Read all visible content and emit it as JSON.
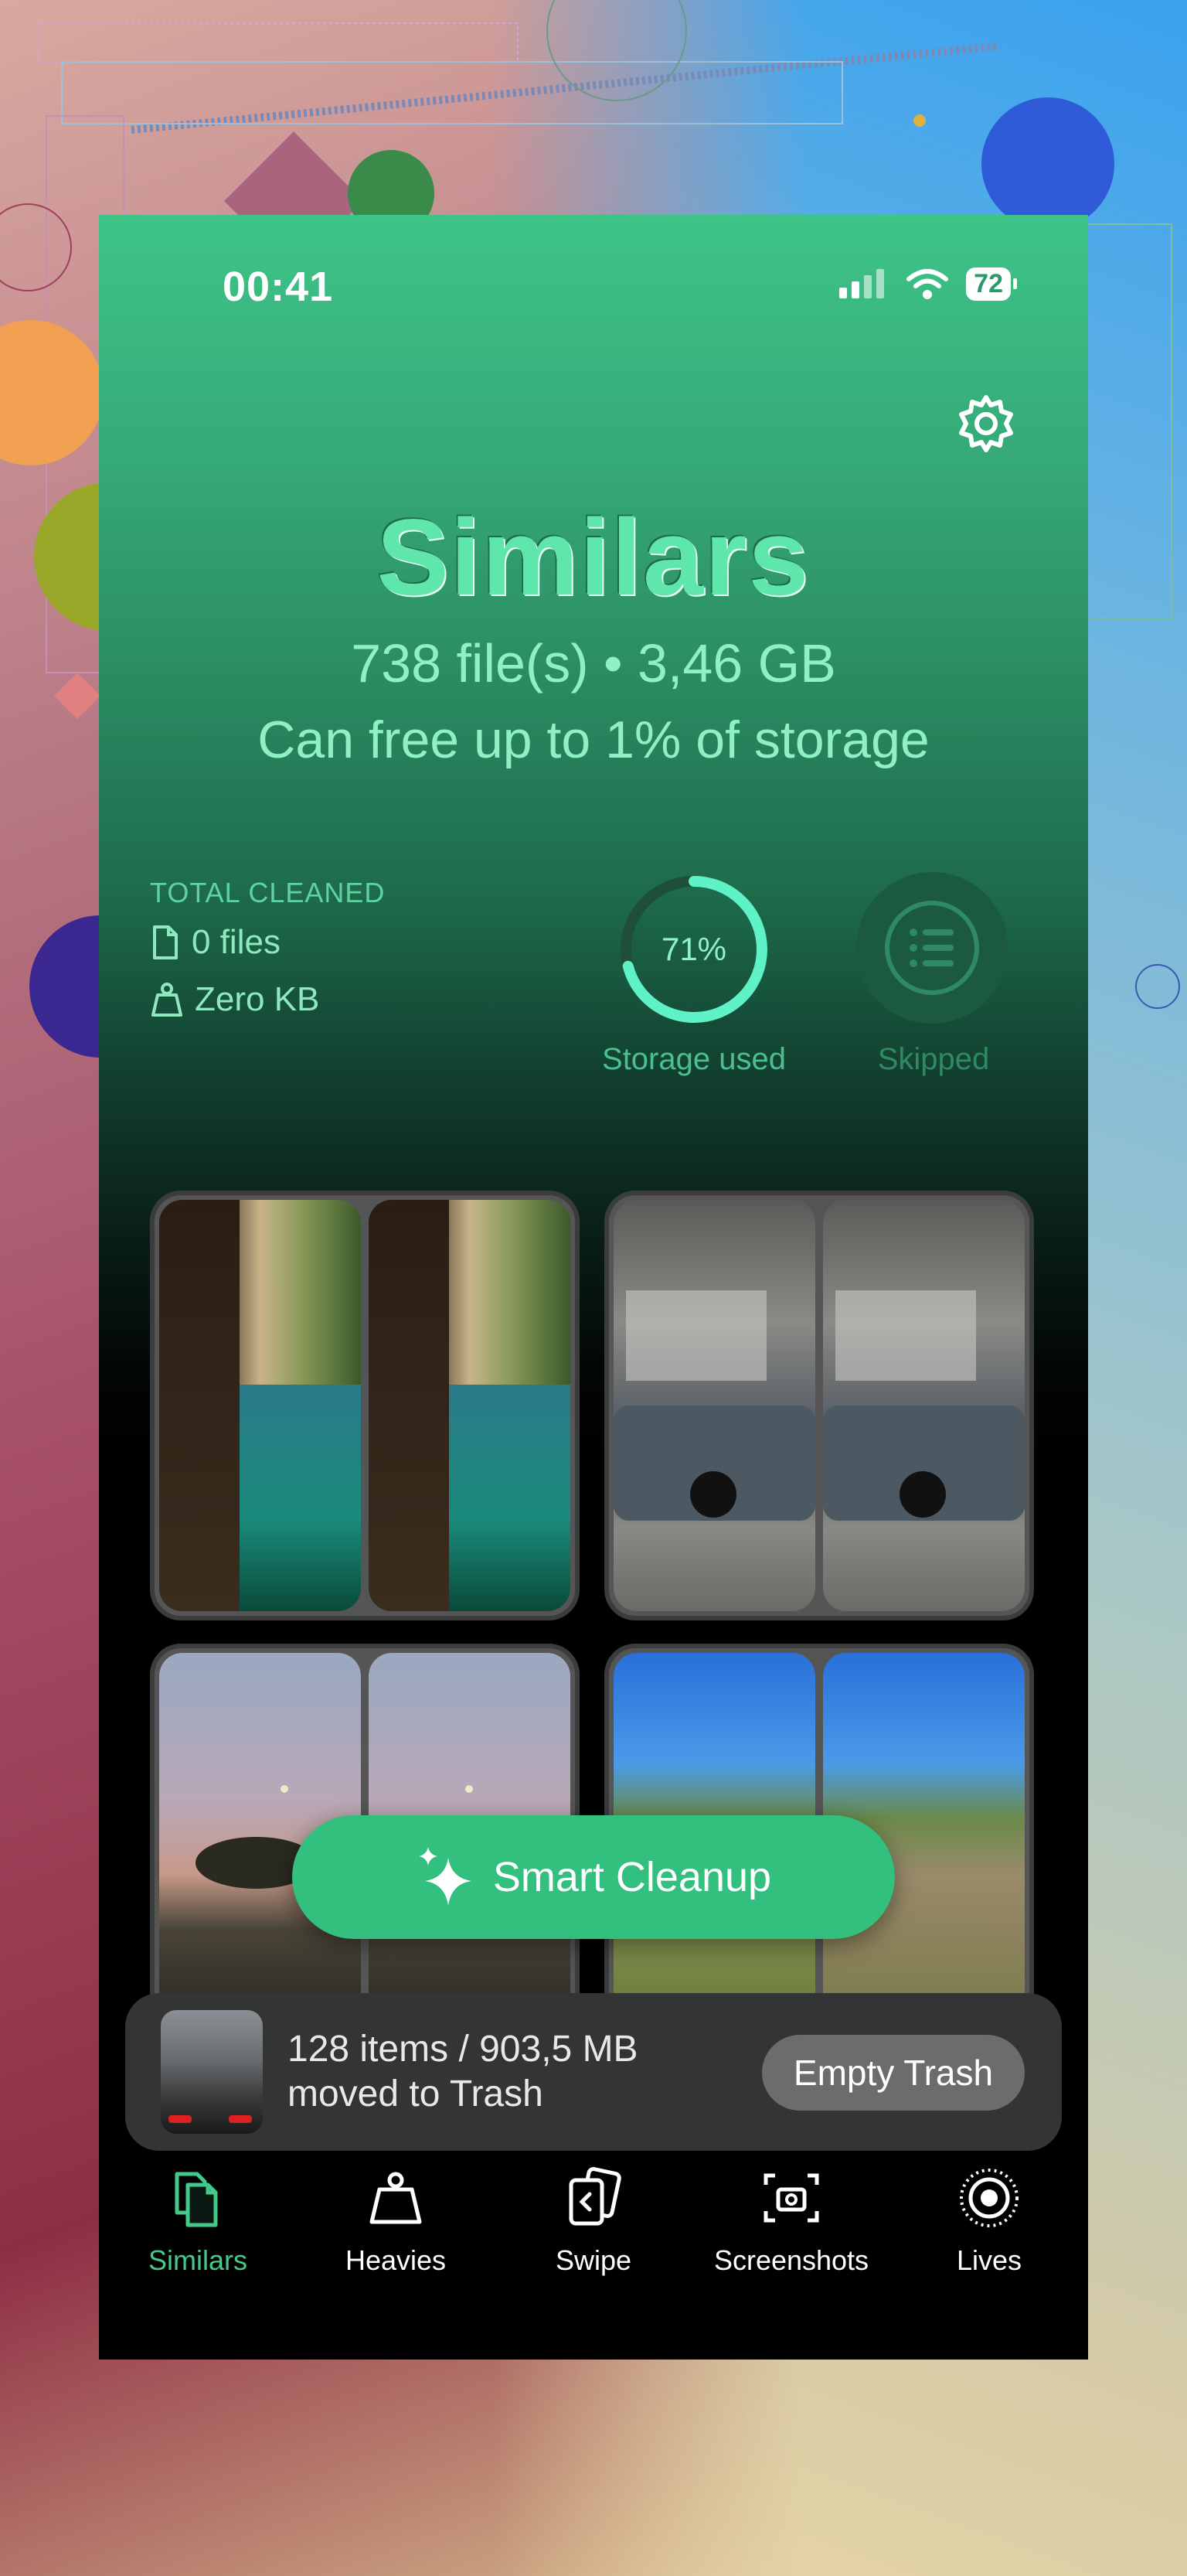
{
  "status_bar": {
    "time": "00:41",
    "battery": "72"
  },
  "header": {
    "title": "Similars",
    "summary": "738 file(s) • 3,46 GB",
    "storage_note": "Can free up to 1% of storage"
  },
  "stats": {
    "total_cleaned_label": "TOTAL CLEANED",
    "files": "0 files",
    "size": "Zero KB",
    "storage_percent": "71%",
    "storage_fraction": 0.71,
    "storage_label": "Storage used",
    "skipped_label": "Skipped"
  },
  "smart_cleanup": {
    "label": "Smart Cleanup"
  },
  "trash": {
    "line1": "128 items / 903,5 MB",
    "line2": "moved to Trash",
    "button": "Empty Trash"
  },
  "tabs": [
    {
      "label": "Similars",
      "icon": "similars-icon",
      "active": true
    },
    {
      "label": "Heavies",
      "icon": "weight-icon",
      "active": false
    },
    {
      "label": "Swipe",
      "icon": "swipe-cards-icon",
      "active": false
    },
    {
      "label": "Screenshots",
      "icon": "screenshot-icon",
      "active": false
    },
    {
      "label": "Lives",
      "icon": "live-photo-icon",
      "active": false
    }
  ],
  "colors": {
    "accent": "#33bf7e",
    "accent_light": "#8ff0c3",
    "bar": "#333534"
  }
}
